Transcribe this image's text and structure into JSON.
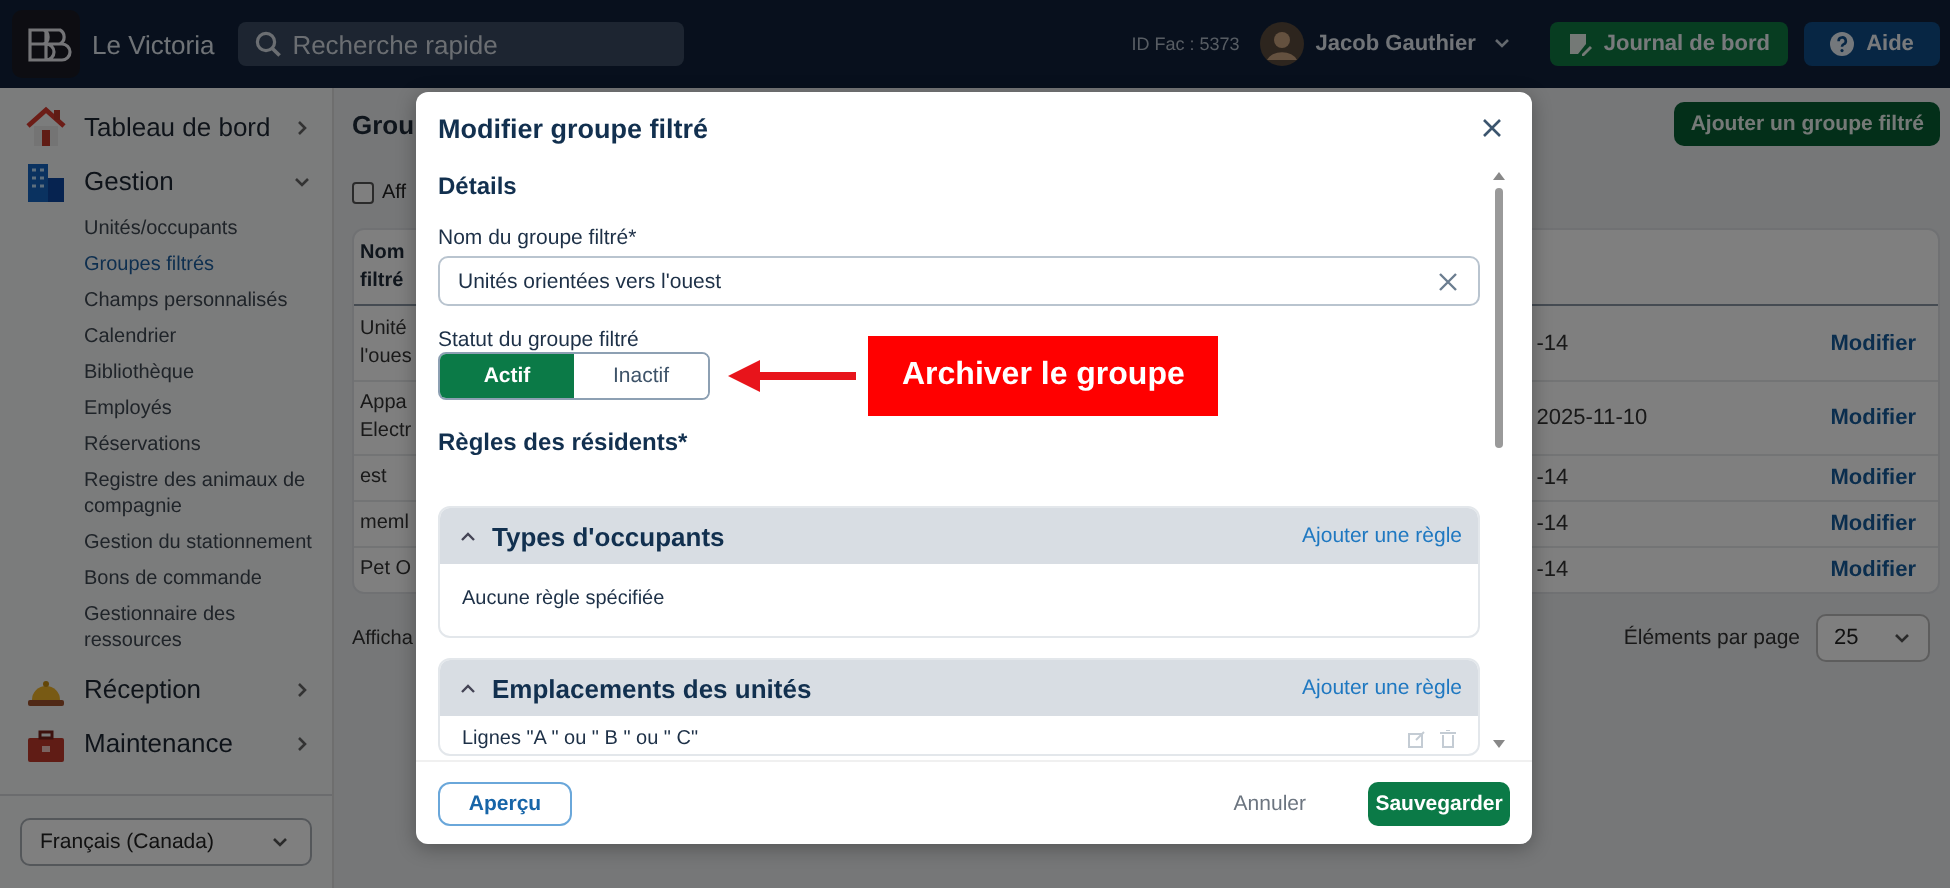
{
  "topbar": {
    "brand": "Le Victoria",
    "search": {
      "placeholder": "Recherche rapide"
    },
    "facility_id": "ID Fac : 5373",
    "user": "Jacob Gauthier",
    "buttons": [
      {
        "label": "Journal de bord",
        "kind": "journal"
      },
      {
        "label": "Aide",
        "kind": "help"
      }
    ]
  },
  "sidebar": {
    "items": [
      {
        "label": "Tableau de bord",
        "expanded": false
      },
      {
        "label": "Gestion",
        "expanded": true,
        "children": [
          {
            "label": "Unités/occupants",
            "selected": false
          },
          {
            "label": "Groupes filtrés",
            "selected": true
          },
          {
            "label": "Champs personnalisés",
            "selected": false
          },
          {
            "label": "Calendrier",
            "selected": false
          },
          {
            "label": "Bibliothèque",
            "selected": false
          },
          {
            "label": "Employés",
            "selected": false
          },
          {
            "label": "Réservations",
            "selected": false
          },
          {
            "label": "Registre des animaux de compagnie",
            "selected": false
          },
          {
            "label": "Gestion du stationnement",
            "selected": false
          },
          {
            "label": "Bons de commande",
            "selected": false
          },
          {
            "label": "Gestionnaire des ressources",
            "selected": false
          }
        ]
      },
      {
        "label": "Réception",
        "expanded": false
      },
      {
        "label": "Maintenance",
        "expanded": false
      }
    ],
    "language": "Français (Canada)"
  },
  "page": {
    "title": "Grou",
    "add_button": "Ajouter un groupe filtré",
    "filter": {
      "label": "Aff",
      "checked": false
    },
    "table": {
      "columns": [
        "Nom filtré"
      ],
      "rows": [
        {
          "name": "Unité l'oues",
          "date": "-14",
          "action": "Modifier"
        },
        {
          "name": "Appa Electr",
          "date": "2025-11-10",
          "action": "Modifier"
        },
        {
          "name": "est",
          "date": "-14",
          "action": "Modifier"
        },
        {
          "name": "meml",
          "date": "-14",
          "action": "Modifier"
        },
        {
          "name": "Pet O",
          "date": "-14",
          "action": "Modifier"
        }
      ]
    },
    "footer_text": "Afficha",
    "per_page": {
      "label": "Éléments par page",
      "value": "25"
    }
  },
  "modal": {
    "title": "Modifier groupe filtré",
    "section": "Détails",
    "name_field": {
      "label": "Nom du groupe filtré*",
      "value": "Unités orientées vers l'ouest"
    },
    "status": {
      "label": "Statut du groupe filtré",
      "options": [
        {
          "label": "Actif",
          "selected": true
        },
        {
          "label": "Inactif",
          "selected": false
        }
      ]
    },
    "annotation": "Archiver le groupe",
    "rules_heading": "Règles des résidents*",
    "rule_groups": [
      {
        "title": "Types d'occupants",
        "expanded": true,
        "action": "Ajouter une règle",
        "empty_text": "Aucune règle spécifiée"
      },
      {
        "title": "Emplacements des unités",
        "expanded": true,
        "action": "Ajouter une règle",
        "rules": [
          "Lignes \"A \" ou \" B \" ou \" C\""
        ]
      }
    ],
    "footer": {
      "preview": "Aperçu",
      "cancel": "Annuler",
      "save": "Sauvegarder"
    }
  }
}
